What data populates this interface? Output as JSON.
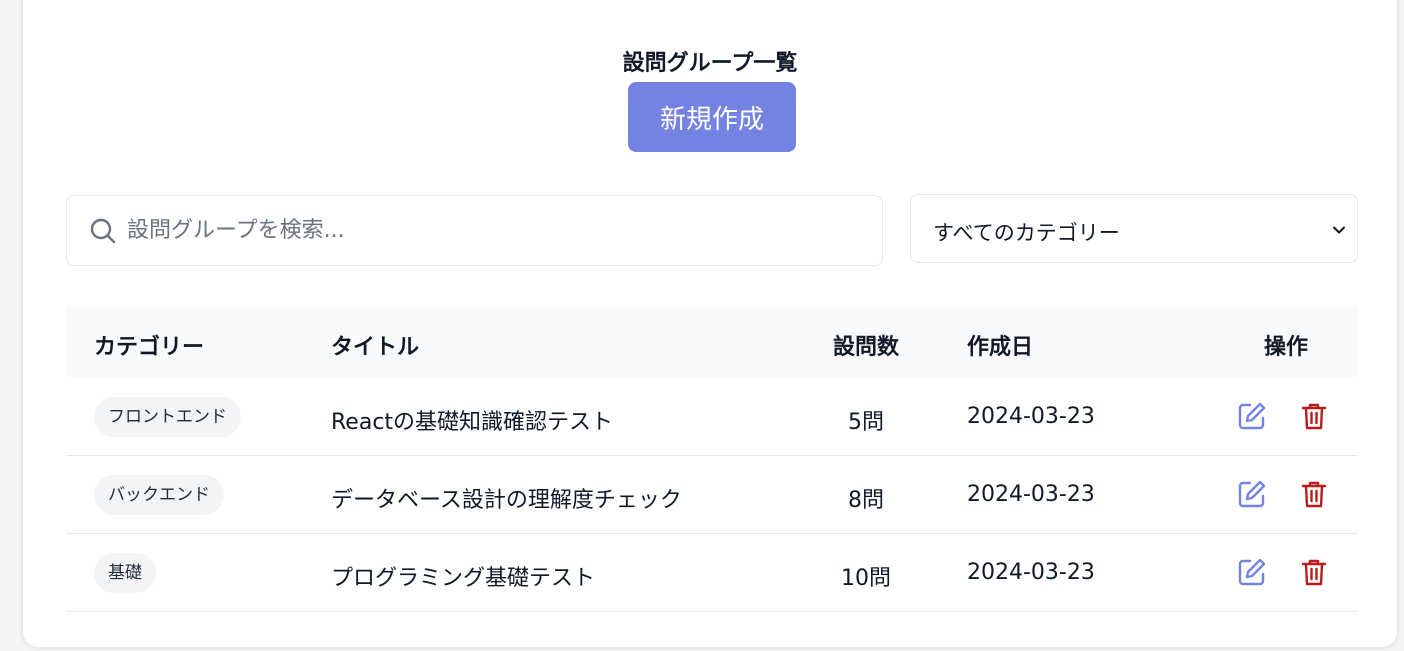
{
  "header": {
    "title": "設問グループ一覧",
    "new_button_label": "新規作成"
  },
  "search": {
    "value": "",
    "placeholder": "設問グループを検索..."
  },
  "filter": {
    "selected": "すべてのカテゴリー"
  },
  "table": {
    "columns": [
      "カテゴリー",
      "タイトル",
      "設問数",
      "作成日",
      "操作"
    ],
    "rows": [
      {
        "category": "フロントエンド",
        "title": "Reactの基礎知識確認テスト",
        "count": "5問",
        "date": "2024-03-23"
      },
      {
        "category": "バックエンド",
        "title": "データベース設計の理解度チェック",
        "count": "8問",
        "date": "2024-03-23"
      },
      {
        "category": "基礎",
        "title": "プログラミング基礎テスト",
        "count": "10問",
        "date": "2024-03-23"
      }
    ]
  },
  "icons": {
    "search": "search-icon",
    "chevron": "chevron-down-icon",
    "edit": "edit-icon",
    "delete": "trash-icon"
  },
  "colors": {
    "accent": "#7483e2",
    "edit_icon": "#7483e2",
    "delete_icon": "#b91c1c",
    "header_bg": "#f9fafb",
    "badge_bg": "#f3f4f6"
  }
}
